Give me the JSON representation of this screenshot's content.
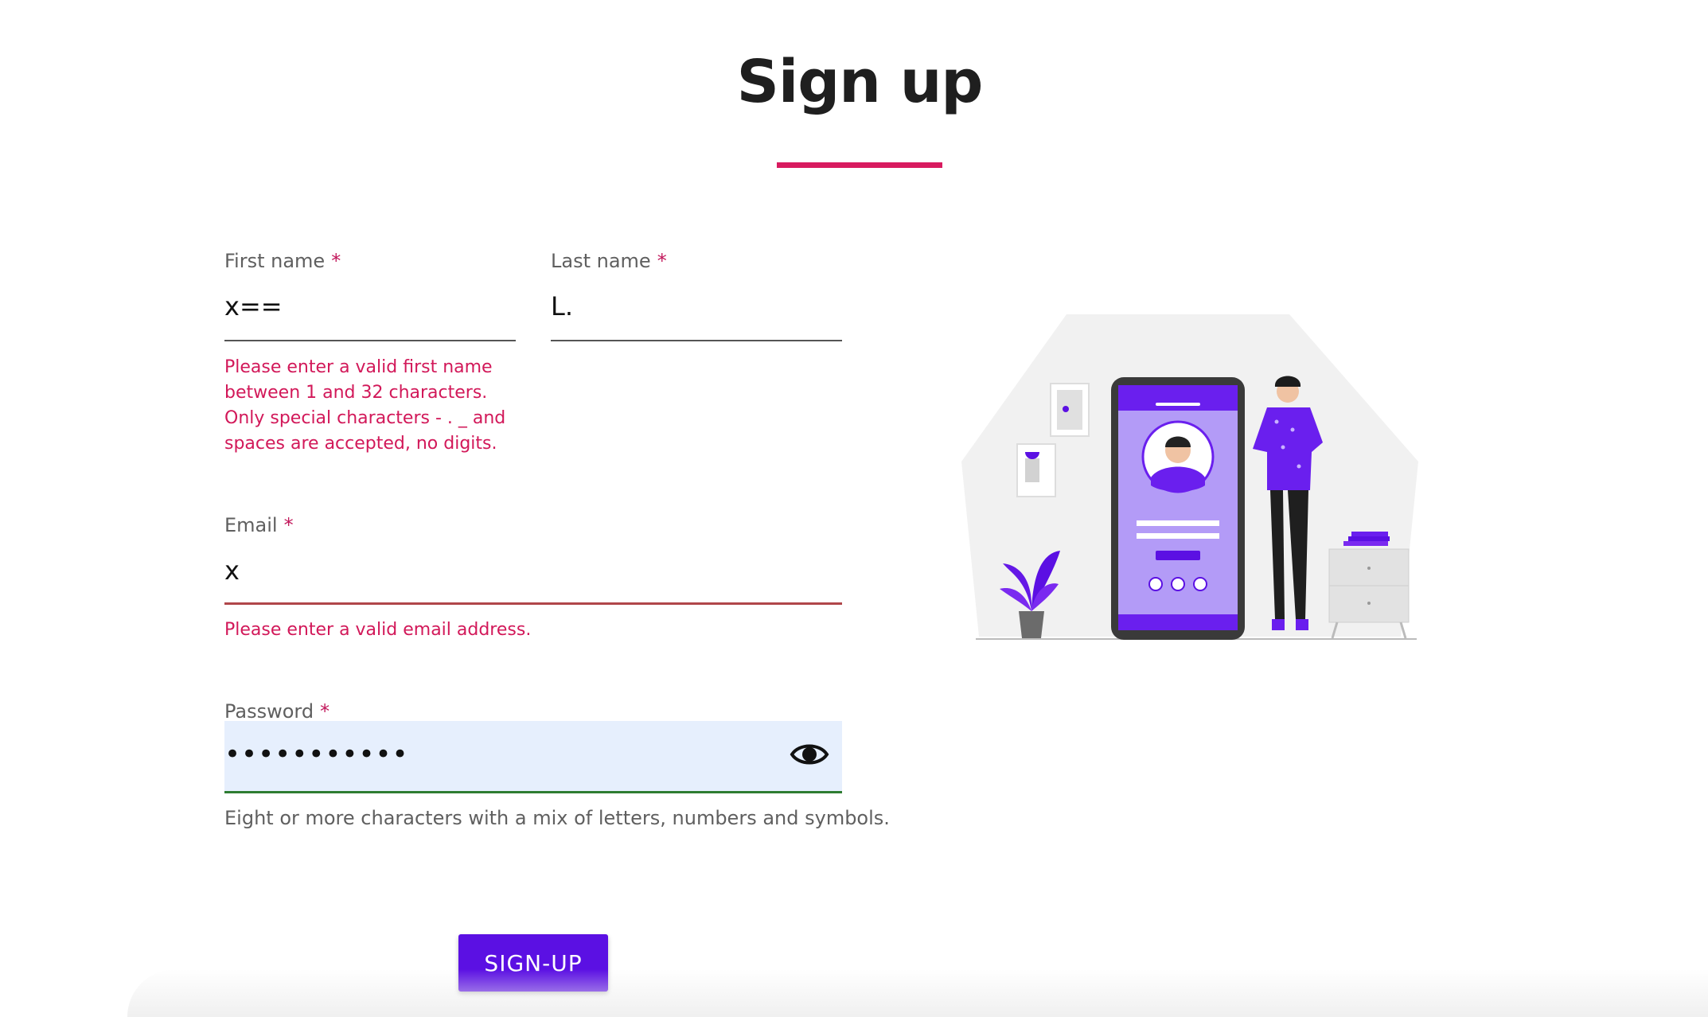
{
  "page": {
    "title": "Sign up"
  },
  "form": {
    "required_marker": "*",
    "first_name": {
      "label": "First name",
      "value": "x==",
      "error": "Please enter a valid first name between 1 and 32 characters. Only special characters - . _ and spaces are accepted, no digits."
    },
    "last_name": {
      "label": "Last name",
      "value": "L."
    },
    "email": {
      "label": "Email",
      "value": "x",
      "error": "Please enter a valid email address."
    },
    "password": {
      "label": "Password",
      "value": "•••••••••••",
      "hint": "Eight or more characters with a mix of letters, numbers and symbols."
    },
    "submit_label": "SIGN-UP"
  },
  "colors": {
    "accent": "#5b10e3",
    "error": "#d21859",
    "title_underline": "#d81b60",
    "password_valid": "#2e7d32"
  },
  "icons": {
    "password_toggle": "eye-icon",
    "social": [
      "facebook-icon",
      "instagram-icon",
      "twitter-icon"
    ]
  }
}
